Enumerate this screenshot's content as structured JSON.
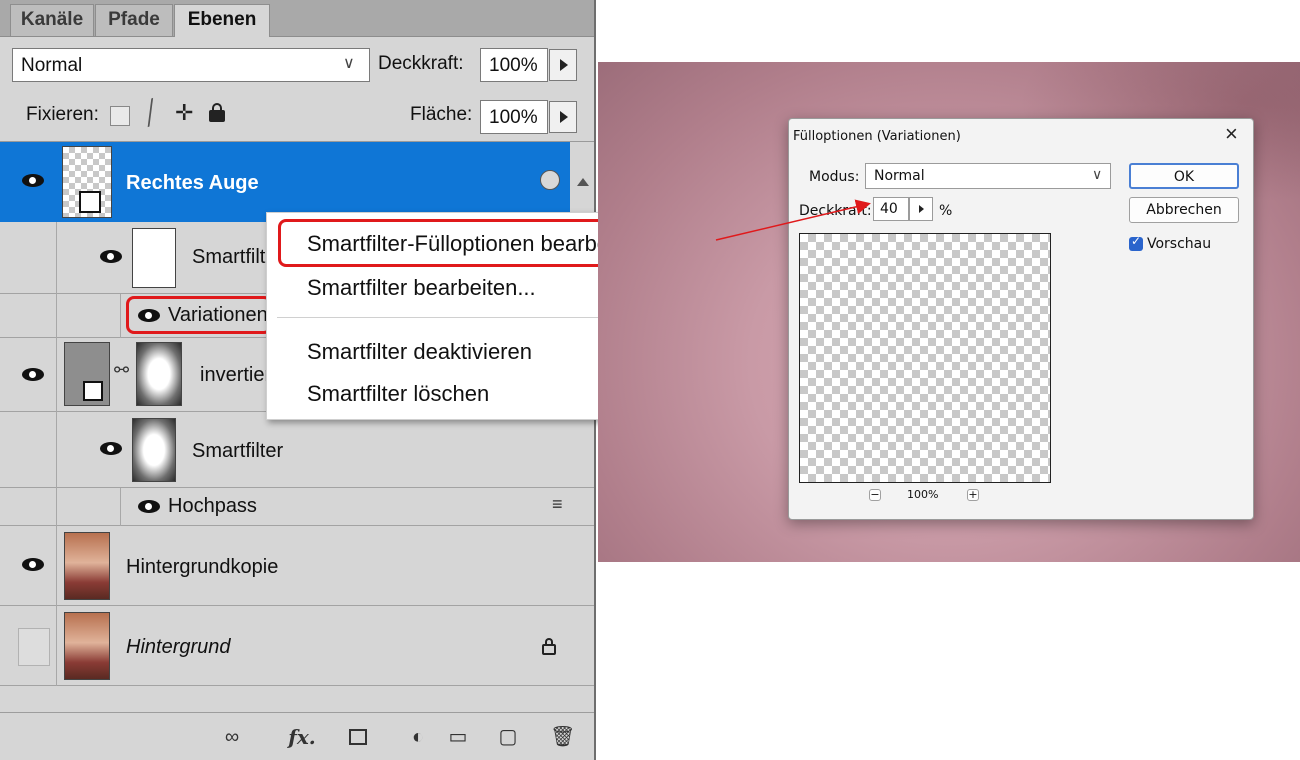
{
  "panel": {
    "tabs": [
      "Kanäle",
      "Pfade",
      "Ebenen"
    ],
    "blend_mode": "Normal",
    "opacity_label": "Deckkraft:",
    "opacity_value": "100%",
    "lock_label": "Fixieren:",
    "fill_label": "Fläche:",
    "fill_value": "100%",
    "layers": {
      "rechtes_auge": "Rechtes Auge",
      "smartfilter_1": "Smartfilter",
      "variationen": "Variationen",
      "invertiert": "invertiert",
      "smartfilter_2": "Smartfilter",
      "hochpass": "Hochpass",
      "hintergrundkopie": "Hintergrundkopie",
      "hintergrund": "Hintergrund"
    }
  },
  "context_menu": {
    "items": [
      "Smartfilter-Fülloptionen bearbeiten...",
      "Smartfilter bearbeiten...",
      "Smartfilter deaktivieren",
      "Smartfilter löschen"
    ]
  },
  "dialog": {
    "title": "Fülloptionen (Variationen)",
    "mode_label": "Modus:",
    "mode_value": "Normal",
    "opacity_label": "Deckkraft:",
    "opacity_value": "40",
    "percent_sign": "%",
    "ok_label": "OK",
    "cancel_label": "Abbrechen",
    "preview_label": "Vorschau",
    "preview_checked": true,
    "zoom_value": "100%",
    "close_glyph": "×",
    "minus_glyph": "−",
    "plus_glyph": "+"
  },
  "colors": {
    "selection_blue": "#0f76d6",
    "callout_red": "#e0191b",
    "checkbox_blue": "#2a64cc"
  }
}
